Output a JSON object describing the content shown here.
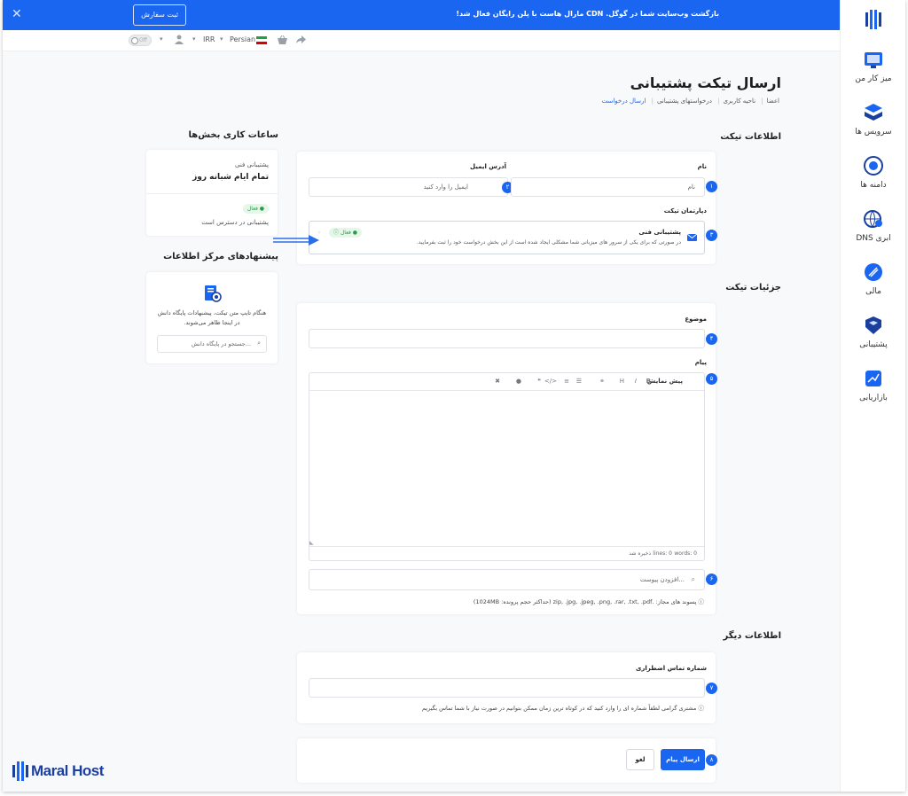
{
  "banner": {
    "text": "بازگشت وب‌سایت شما در گوگل. CDN مارال هاست با پلن رایگان فعال شد!",
    "button": "ثبت سفارش",
    "close": "✕"
  },
  "toolbar": {
    "language": "Persian",
    "currency": "IRR",
    "toggle": "Off"
  },
  "sidebar": {
    "items": [
      {
        "label": "میز کار من",
        "icon": "desk-icon"
      },
      {
        "label": "سرویس ها",
        "icon": "services-icon"
      },
      {
        "label": "دامنه ها",
        "icon": "domain-icon"
      },
      {
        "label": "DNS ابری",
        "icon": "cloud-dns-icon"
      },
      {
        "label": "مالی",
        "icon": "finance-icon"
      },
      {
        "label": "پشتیبانی",
        "icon": "support-icon"
      },
      {
        "label": "بازاریابی",
        "icon": "marketing-icon"
      }
    ]
  },
  "page": {
    "title": "ارسال تیکت پشتیبانی",
    "breadcrumb": [
      "اعضا",
      "ناحیه کاربری",
      "درخواستهای پشتیبانی",
      "ارسال درخواست"
    ]
  },
  "ticket_info": {
    "title": "اطلاعات تیکت",
    "name_label": "نام",
    "name_placeholder": "نام",
    "email_label": "آدرس ایمیل",
    "email_placeholder": "ایمیل را وارد کنید",
    "dept_label": "دپارتمان تیکت",
    "dept": {
      "name": "پشتیبانی فنی",
      "desc": "در صورتی که برای یکی از سرور های میزبانی شما مشکلی ایجاد شده است از این بخش درخواست خود را ثبت بفرمایید.",
      "status": "فعال"
    }
  },
  "ticket_details": {
    "title": "جزئیات تیکت",
    "subject_label": "موضوع",
    "message_label": "پیام",
    "preview": "پیش نمایش",
    "footer": {
      "words": "words: 0",
      "lines": "lines: 0",
      "saved": "ذخیره شد"
    },
    "attach_placeholder": "افزودن پیوست...",
    "allowed": "پسوند های مجاز: .zip, .jpg, .jpeg, .png, .rar, .txt, .pdf (حداکثر حجم پرونده: 1024MB)"
  },
  "other_info": {
    "title": "اطلاعات دیگر",
    "phone_label": "شماره تماس اضطراری",
    "phone_note": "مشتری گرامی لطفاً شماره ای را وارد کنید که در کوتاه ترین زمان ممکن بتوانیم در صورت نیاز با شما تماس بگیریم"
  },
  "actions": {
    "submit": "ارسال پیام",
    "cancel": "لغو"
  },
  "hours": {
    "title": "ساعات کاری بخش‌ها",
    "dept": "پشتیبانی فنی",
    "value": "تمام ایام شبانه روز",
    "status": "فعال",
    "status_text": "پشتیبانی در دسترس است"
  },
  "kb": {
    "title": "پیشنهادهای مرکز اطلاعات",
    "desc": "هنگام تایپ متن تیکت، پیشنهادات پایگاه دانش در اینجا ظاهر می‌شوند.",
    "search_placeholder": "جستجو در پایگاه دانش..."
  },
  "steps": [
    "۱",
    "۲",
    "۳",
    "۴",
    "۵",
    "۶",
    "۷",
    "۸"
  ],
  "logo": {
    "text": "Maral Host"
  },
  "colors": {
    "accent": "#1a66f0",
    "success": "#2c9a47"
  }
}
